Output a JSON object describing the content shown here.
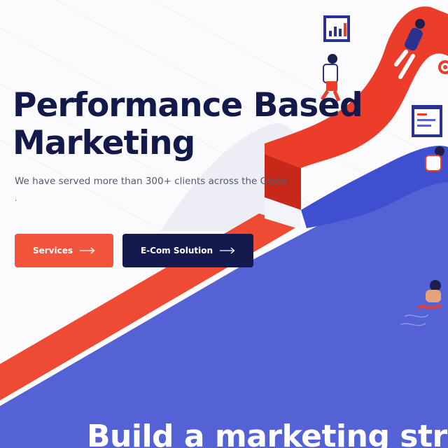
{
  "hero": {
    "title_line1": "Performance Based",
    "title_line2": "Marketing",
    "subtitle": "We have served more than 300+ clients across the Globe",
    "dot": "."
  },
  "buttons": {
    "services_label": "Services",
    "ecom_label": "E-Com Solution"
  },
  "section": {
    "heading": "Build a marketing stra"
  },
  "colors": {
    "navy": "#131a4a",
    "coral": "#f2553b",
    "blue": "#5462d6",
    "red": "#ec3d2a"
  },
  "icons": {
    "button_arrow": "long-arrow-right-icon",
    "chart_board": "bar-chart-board-icon",
    "browser_board": "browser-window-icon",
    "target": "target-icon"
  }
}
